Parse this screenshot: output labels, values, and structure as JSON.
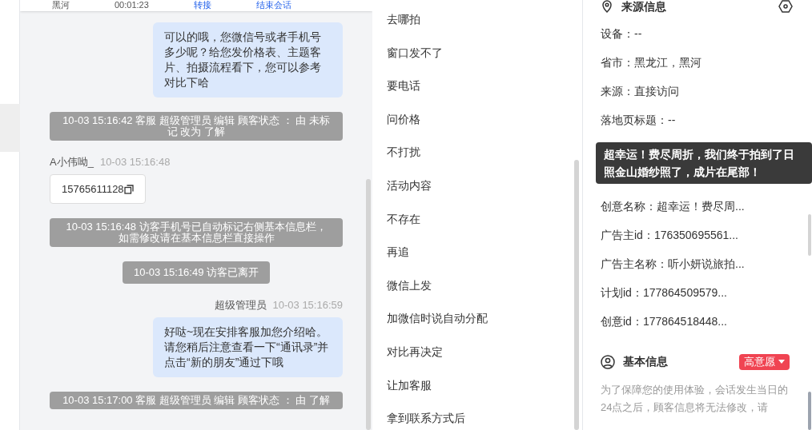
{
  "top_bar": {
    "items": [
      {
        "kind": "text",
        "label": "黑河"
      },
      {
        "kind": "text",
        "label": "00:01:23"
      },
      {
        "kind": "link",
        "label": "转接"
      },
      {
        "kind": "link",
        "label": "结束会话"
      }
    ]
  },
  "chat": [
    {
      "kind": "agent",
      "text": "可以的哦，您微信号或者手机号多少呢？给您发价格表、主题客片、拍摄流程看下，您可以参考对比下哈"
    },
    {
      "kind": "system",
      "text": "10-03 15:16:42 客服 超级管理员 编辑 顾客状态 ： 由 未标记 改为 了解"
    },
    {
      "kind": "visitor_header",
      "name": "A小伟呦_",
      "time": "10-03 15:16:48"
    },
    {
      "kind": "phone",
      "text": "15765611128"
    },
    {
      "kind": "system",
      "text": "10-03 15:16:48 访客手机号已自动标记右侧基本信息栏，如需修改请在基本信息栏直接操作"
    },
    {
      "kind": "notice",
      "text": "10-03 15:16:49 访客已离开"
    },
    {
      "kind": "agent_header",
      "name": "超级管理员",
      "time": "10-03 15:16:59"
    },
    {
      "kind": "agent",
      "text": "好哒~现在安排客服加您介绍哈。请您稍后注意查看一下“通讯录”并点击“新的朋友”通过下哦"
    },
    {
      "kind": "system",
      "text": "10-03 15:17:00 客服 超级管理员 编辑 顾客状态 ： 由 了解"
    }
  ],
  "quick_replies": [
    "去哪拍",
    "窗口发不了",
    "要电话",
    "问价格",
    "不打扰",
    "活动内容",
    "不存在",
    "再追",
    "微信上发",
    "加微信时说自动分配",
    "对比再决定",
    "让加客服",
    "拿到联系方式后"
  ],
  "source_info": {
    "title": "来源信息",
    "rows": [
      {
        "kind": "row",
        "text": "设备：--"
      },
      {
        "kind": "row",
        "text": "省市：黑龙江，黑河"
      },
      {
        "kind": "row",
        "text": "来源：直接访问"
      },
      {
        "kind": "row",
        "text": "落地页标题：--"
      },
      {
        "kind": "tooltip",
        "text": "超幸运！费尽周折，我们终于拍到了日照金山婚纱照了，成片在尾部！"
      },
      {
        "kind": "row",
        "text": "创意名称：超幸运！费尽周..."
      },
      {
        "kind": "row",
        "text": "广告主id：176350695561..."
      },
      {
        "kind": "row",
        "text": "广告主名称：听小妍说旅拍..."
      },
      {
        "kind": "row",
        "text": "计划id：177864509579..."
      },
      {
        "kind": "row",
        "text": "创意id：177864518448..."
      }
    ]
  },
  "basic_info": {
    "title": "基本信息",
    "intent_tag": "高意愿",
    "notice": "为了保障您的使用体验，会话发生当日的24点之后，顾客信息将无法修改，请"
  }
}
